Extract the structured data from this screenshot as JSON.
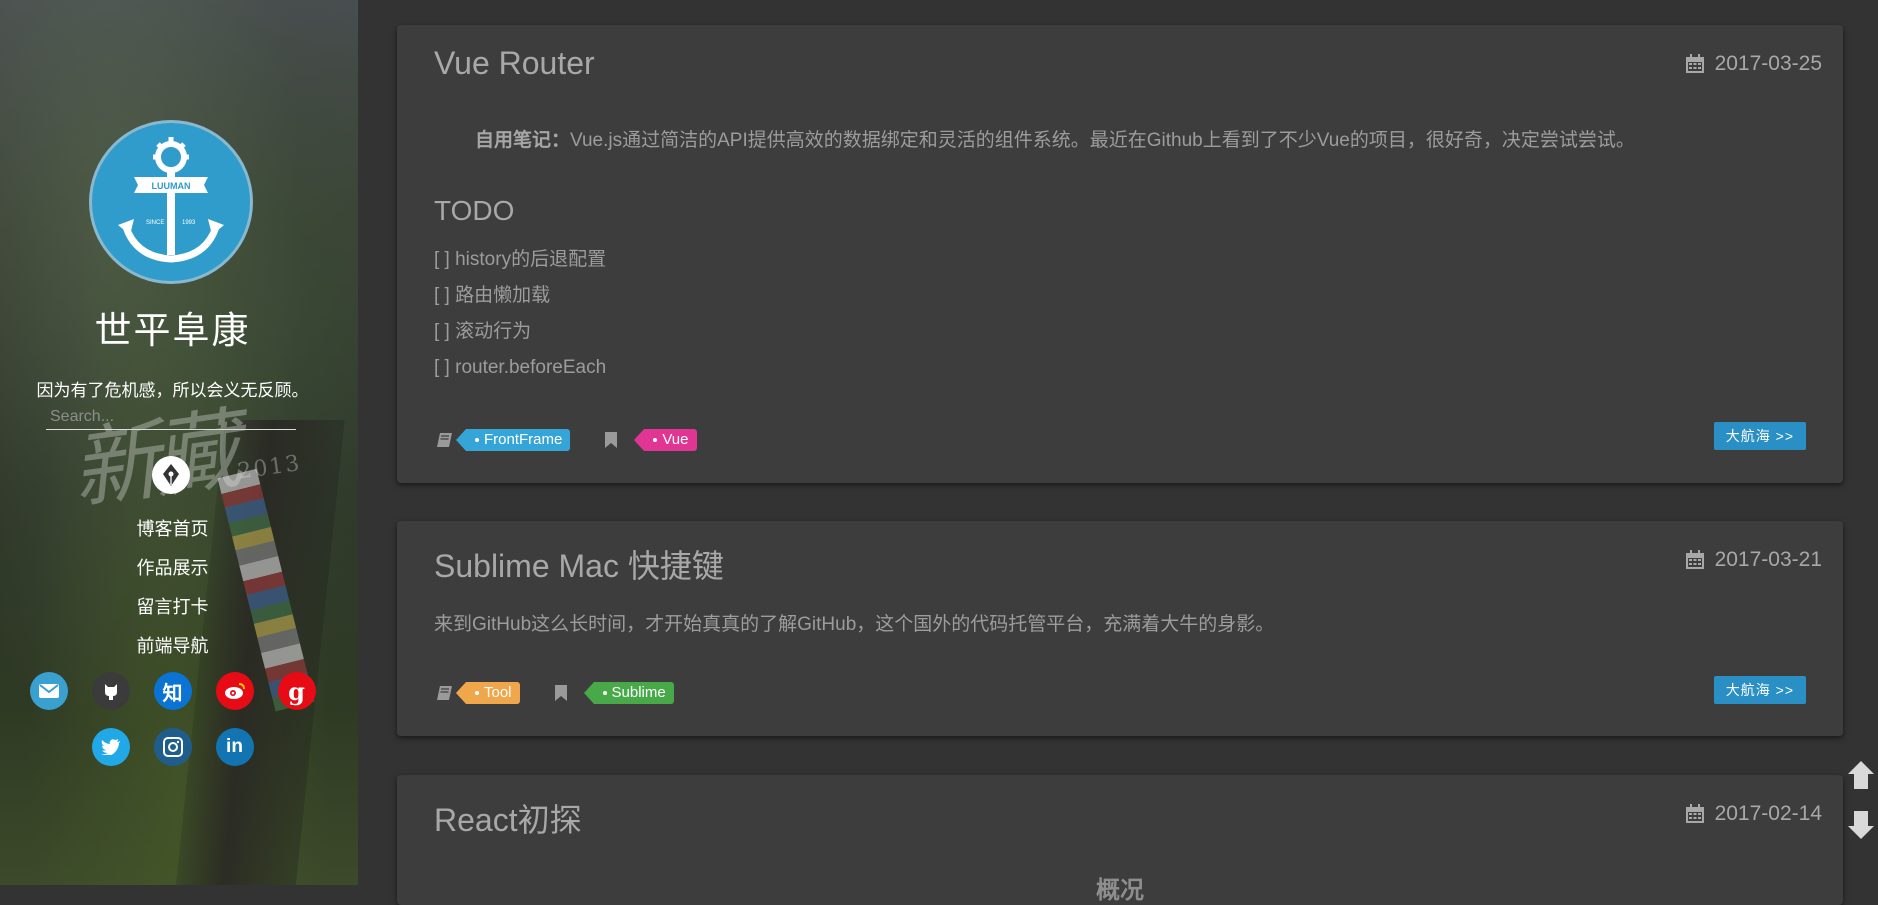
{
  "sidebar": {
    "title": "世平阜康",
    "motto": "因为有了危机感，所以会义无反顾。",
    "search_placeholder": "Search...",
    "watermark_text": "新藏",
    "watermark_year": "2013",
    "avatar": {
      "banner_text": "LUUMAN",
      "since_text": "SINCE",
      "year_text": "1993"
    },
    "nav": [
      {
        "label": "博客首页"
      },
      {
        "label": "作品展示"
      },
      {
        "label": "留言打卡"
      },
      {
        "label": "前端导航"
      }
    ],
    "social_row1": [
      {
        "icon": "mail-icon",
        "color": "#3aa0d0"
      },
      {
        "icon": "github-icon",
        "color": "#3b3b3b"
      },
      {
        "icon": "zhihu-icon",
        "label": "知",
        "color": "#0a73d3"
      },
      {
        "icon": "weibo-icon",
        "color": "#e60b15"
      },
      {
        "icon": "google-icon",
        "label": "g",
        "color": "#e60b15"
      }
    ],
    "social_row2": [
      {
        "icon": "twitter-icon",
        "color": "#21a9e7"
      },
      {
        "icon": "instagram-icon",
        "color": "#1f5e8c"
      },
      {
        "icon": "linkedin-icon",
        "label": "in",
        "color": "#1275b1"
      }
    ]
  },
  "posts": [
    {
      "title": "Vue Router",
      "date": "2017-03-25",
      "excerpt_bold": "自用笔记：",
      "excerpt": "Vue.js通过简洁的API提供高效的数据绑定和灵活的组件系统。最近在Github上看到了不少Vue的项目，很好奇，决定尝试尝试。",
      "todo_heading": "TODO",
      "todos": [
        "[ ] history的后退配置",
        "[ ] 路由懒加载",
        "[ ] 滚动行为",
        "[ ] router.beforeEach"
      ],
      "category": {
        "label": "FrontFrame",
        "color": "#35a5d8"
      },
      "tag": {
        "label": "Vue",
        "color": "#e03592"
      },
      "read_more": "大航海 >>"
    },
    {
      "title": "Sublime Mac 快捷键",
      "date": "2017-03-21",
      "excerpt": "来到GitHub这么长时间，才开始真真的了解GitHub，这个国外的代码托管平台，充满着大牛的身影。",
      "category": {
        "label": "Tool",
        "color": "#f0a64a"
      },
      "tag": {
        "label": "Sublime",
        "color": "#48a948"
      },
      "read_more": "大航海 >>"
    },
    {
      "title": "React初探",
      "date": "2017-02-14",
      "subheading": "概况"
    }
  ],
  "scroll": {
    "up_icon": "arrow-up-icon",
    "down_icon": "arrow-down-icon"
  }
}
